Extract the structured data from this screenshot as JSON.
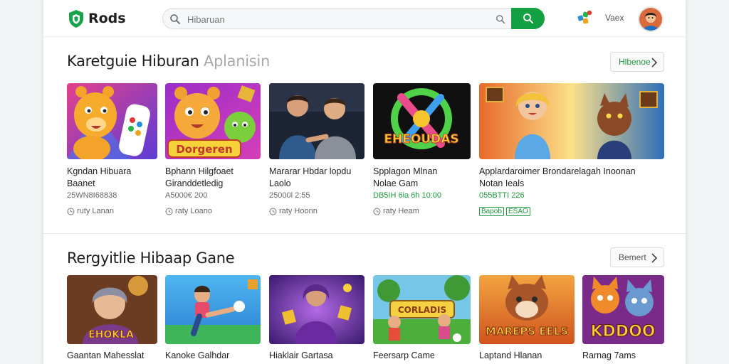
{
  "header": {
    "logo_text": "Rods",
    "search_placeholder": "Hibaruan",
    "user_name": "Vaex"
  },
  "colors": {
    "accent": "#13a043",
    "text": "#1d1d1d"
  },
  "section1": {
    "title": "Karetguie Hiburan",
    "title_sub": "Aplanisin",
    "more_label": "Hlbenoe",
    "games": [
      {
        "name_line1": "Kgndan Hibuara",
        "name_line2": "Baanet",
        "meta": "25WN8I68838",
        "rating": "ruty Lanan"
      },
      {
        "name_line1": "Bphann Hilgfoaet",
        "name_line2": "Giranddetledig",
        "meta": "A5000€ 200",
        "rating": "raty Loano"
      },
      {
        "name_line1": "Mararar Hbdar lopdu",
        "name_line2": "Laolo",
        "meta": "25000l 2:55",
        "rating": "raty Hoonn"
      },
      {
        "name_line1": "Spplagon Mlnan",
        "name_line2": "Nolae Gam",
        "meta": "DB5IH 6ia 6h 10:00",
        "rating": "raty Heam"
      },
      {
        "name_line1": "Applardaroimer Brondarelagah Inoonan",
        "name_line2": "Notan Ieals",
        "meta": "055BTTI 226",
        "badge1": "Bapob",
        "badge2": "ESAO"
      }
    ]
  },
  "section2": {
    "title": "Rergyitlie Hibaap Gane",
    "more_label": "Bemert",
    "games": [
      {
        "name": "Gaantan Mahesslat",
        "art_text": "EHOKLA"
      },
      {
        "name": "Kanoke Galhdar"
      },
      {
        "name": "Hiaklair Gartasa"
      },
      {
        "name": "Feersarp Came",
        "art_text": "CORLADIS"
      },
      {
        "name": "Laptand Hlanan",
        "art_text": "MAREPS EELS"
      },
      {
        "name": "Rarnag 7ams",
        "art_text": "KDDOO"
      }
    ]
  },
  "section1_art": {
    "tile3_text": "EHEOUDAS",
    "tile2_text": "Dorgeren"
  }
}
